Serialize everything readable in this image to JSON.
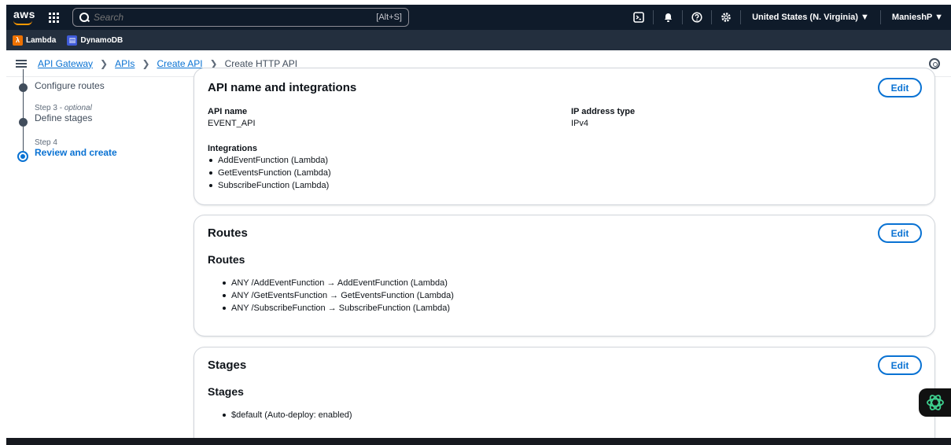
{
  "topnav": {
    "brand": "aws",
    "search_placeholder": "Search",
    "search_shortcut": "[Alt+S]",
    "region": "United States (N. Virginia) ▼",
    "user": "ManieshP ▼"
  },
  "favorites": [
    {
      "label": "Lambda",
      "color": "#ed7100"
    },
    {
      "label": "DynamoDB",
      "color": "#3f5bd8"
    }
  ],
  "breadcrumb": {
    "items": [
      "API Gateway",
      "APIs",
      "Create API"
    ],
    "current": "Create HTTP API"
  },
  "steps": {
    "step2_label": "Configure routes",
    "step3_meta": "Step 3 - ",
    "step3_optional": "optional",
    "step3_label": "Define stages",
    "step4_meta": "Step 4",
    "step4_label": "Review and create"
  },
  "api_section": {
    "title": "API name and integrations",
    "edit_label": "Edit",
    "api_name_label": "API name",
    "api_name_value": "EVENT_API",
    "ip_type_label": "IP address type",
    "ip_type_value": "IPv4",
    "integrations_label": "Integrations",
    "integrations": [
      "AddEventFunction (Lambda)",
      "GetEventsFunction (Lambda)",
      "SubscribeFunction (Lambda)"
    ]
  },
  "routes_section": {
    "title": "Routes",
    "edit_label": "Edit",
    "subtitle": "Routes",
    "routes": [
      "ANY /AddEventFunction → AddEventFunction (Lambda)",
      "ANY /GetEventsFunction → GetEventsFunction (Lambda)",
      "ANY /SubscribeFunction → SubscribeFunction (Lambda)"
    ]
  },
  "stages_section": {
    "title": "Stages",
    "edit_label": "Edit",
    "subtitle": "Stages",
    "stages": [
      "$default (Auto-deploy: enabled)"
    ]
  },
  "colors": {
    "nav_bg": "#0f1b2a",
    "accent": "#0972d3",
    "assistant_green": "#3ecf8e"
  }
}
